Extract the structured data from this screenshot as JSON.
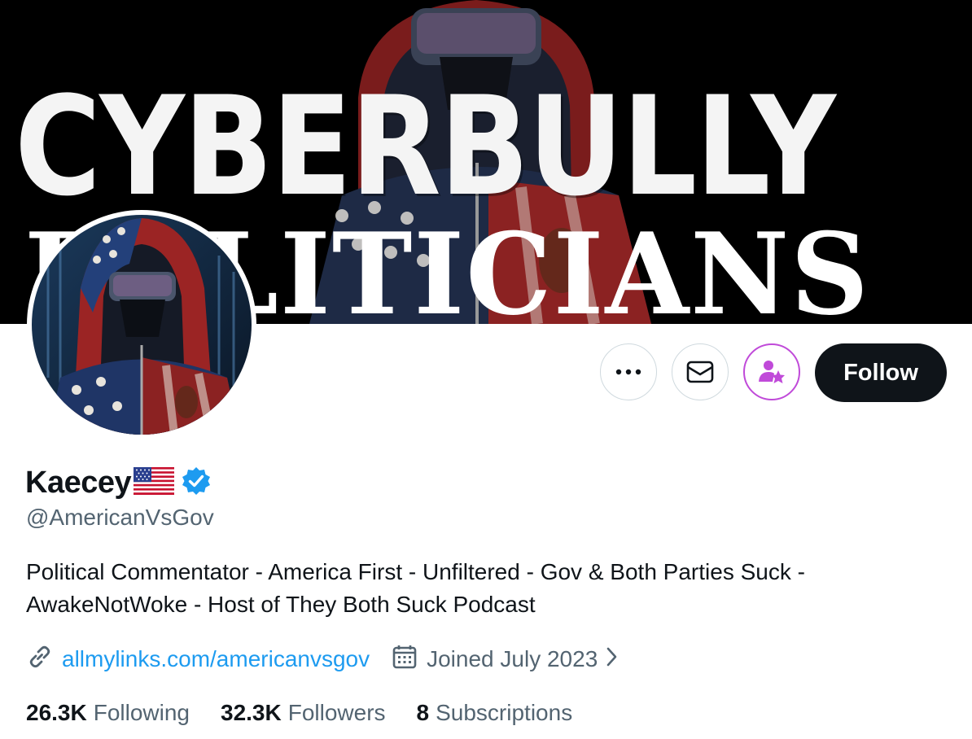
{
  "banner": {
    "line1": "CYBERBULLY",
    "line2": "POLITICIANS"
  },
  "actions": {
    "more_icon": "more-horizontal-icon",
    "message_icon": "envelope-icon",
    "subscribe_icon": "person-star-icon",
    "follow_label": "Follow",
    "subscribe_color": "#c04ad9"
  },
  "profile": {
    "display_name": "Kaecey",
    "flag_icon": "us-flag-icon",
    "verified_icon": "verified-badge-icon",
    "verified_color": "#1d9bf0",
    "handle": "@AmericanVsGov",
    "bio": "Political Commentator - America First - Unfiltered - Gov & Both Parties Suck - AwakeNotWoke - Host of They Both Suck Podcast",
    "link_icon": "link-icon",
    "link_text": "allmylinks.com/americanvsgov",
    "link_color": "#1d9bf0",
    "calendar_icon": "calendar-icon",
    "joined_text": "Joined July 2023"
  },
  "stats": {
    "following_count": "26.3K",
    "following_label": "Following",
    "followers_count": "32.3K",
    "followers_label": "Followers",
    "subscriptions_count": "8",
    "subscriptions_label": "Subscriptions"
  }
}
